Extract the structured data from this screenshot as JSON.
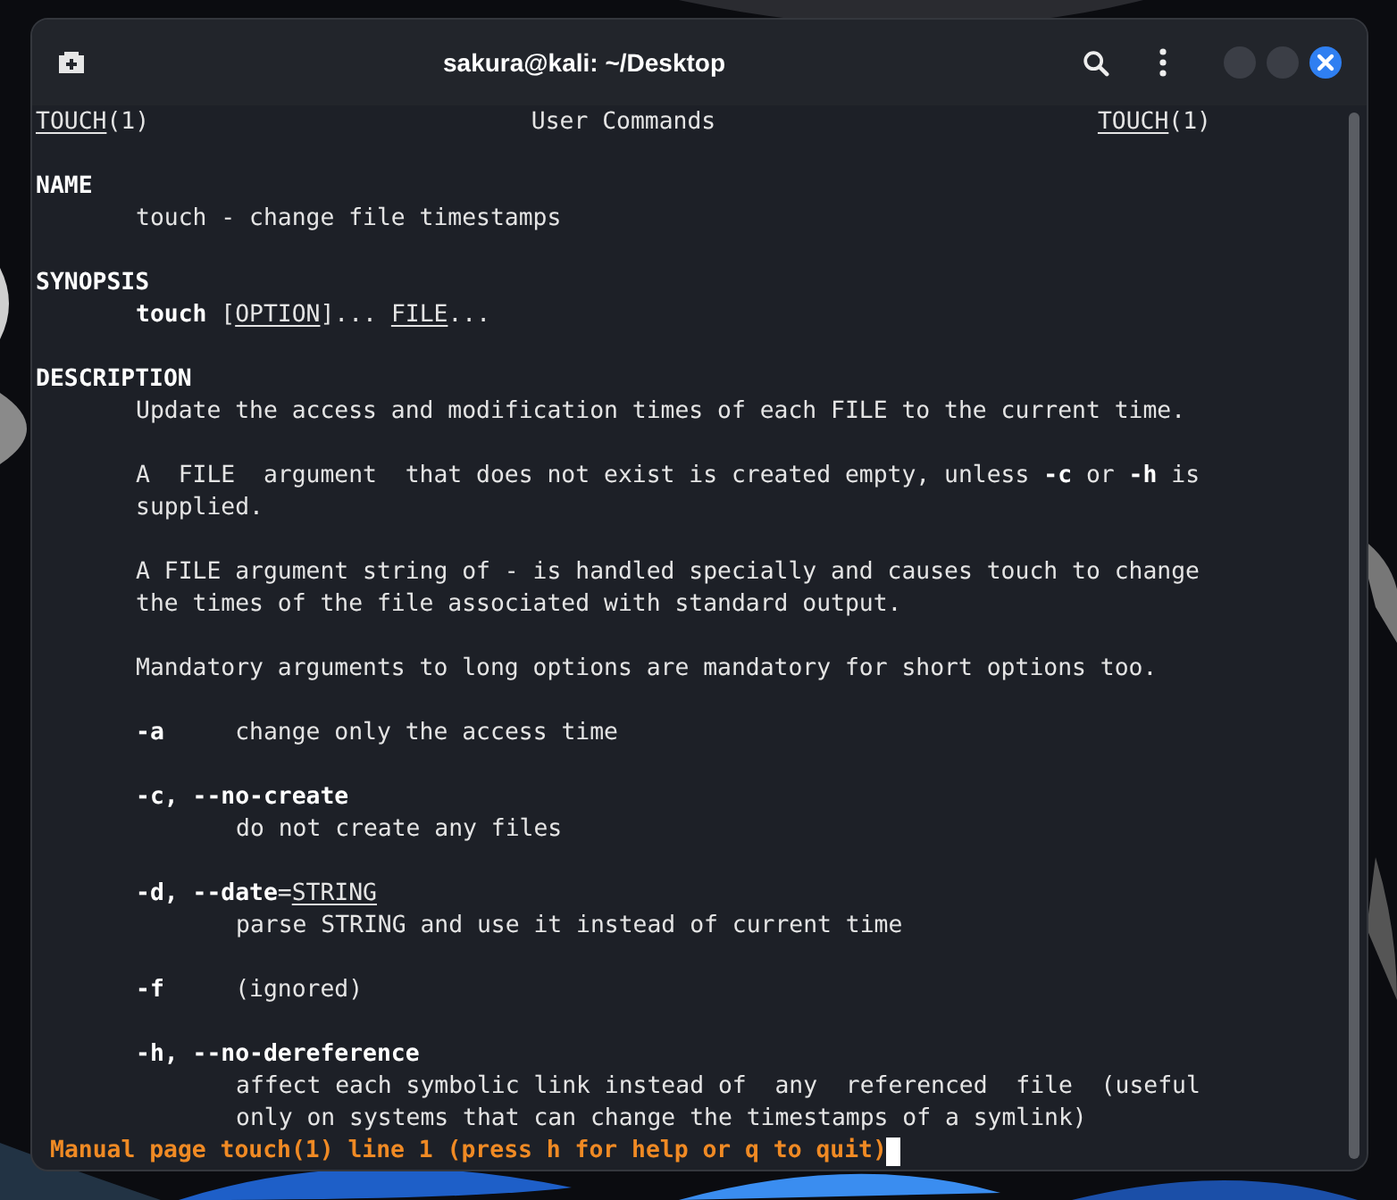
{
  "window": {
    "title": "sakura@kali: ~/Desktop"
  },
  "man_header": {
    "left": [
      {
        "text": "TOUCH",
        "kind": "arg"
      },
      {
        "text": "(1)",
        "kind": "text"
      }
    ],
    "center": "User Commands",
    "right": [
      {
        "text": "TOUCH",
        "kind": "arg"
      },
      {
        "text": "(1)",
        "kind": "text"
      }
    ]
  },
  "sections": [
    {
      "heading": "NAME",
      "paragraphs": [
        {
          "lines": [
            {
              "kind": "body",
              "segments": [
                {
                  "text": "touch - change file timestamps",
                  "kind": "text"
                }
              ]
            }
          ]
        }
      ]
    },
    {
      "heading": "SYNOPSIS",
      "paragraphs": [
        {
          "lines": [
            {
              "kind": "body",
              "segments": [
                {
                  "text": "touch",
                  "kind": "flag"
                },
                {
                  "text": " [",
                  "kind": "text"
                },
                {
                  "text": "OPTION",
                  "kind": "arg"
                },
                {
                  "text": "]... ",
                  "kind": "text"
                },
                {
                  "text": "FILE",
                  "kind": "arg"
                },
                {
                  "text": "...",
                  "kind": "text"
                }
              ]
            }
          ]
        }
      ]
    },
    {
      "heading": "DESCRIPTION",
      "paragraphs": [
        {
          "lines": [
            {
              "kind": "body",
              "segments": [
                {
                  "text": "Update the access and modification times of each FILE to the current time.",
                  "kind": "text"
                }
              ]
            }
          ]
        },
        {
          "lines": [
            {
              "kind": "body",
              "segments": [
                {
                  "text": "A  FILE  argument  that does not exist is created empty, unless ",
                  "kind": "text"
                },
                {
                  "text": "-c",
                  "kind": "flag"
                },
                {
                  "text": " or ",
                  "kind": "text"
                },
                {
                  "text": "-h",
                  "kind": "flag"
                },
                {
                  "text": " is",
                  "kind": "text"
                }
              ]
            },
            {
              "kind": "body",
              "segments": [
                {
                  "text": "supplied.",
                  "kind": "text"
                }
              ]
            }
          ]
        },
        {
          "lines": [
            {
              "kind": "body",
              "segments": [
                {
                  "text": "A FILE argument string of - is handled specially and causes touch to change",
                  "kind": "text"
                }
              ]
            },
            {
              "kind": "body",
              "segments": [
                {
                  "text": "the times of the file associated with standard output.",
                  "kind": "text"
                }
              ]
            }
          ]
        },
        {
          "lines": [
            {
              "kind": "body",
              "segments": [
                {
                  "text": "Mandatory arguments to long options are mandatory for short options too.",
                  "kind": "text"
                }
              ]
            }
          ]
        },
        {
          "lines": [
            {
              "kind": "body",
              "segments": [
                {
                  "text": "-a",
                  "kind": "flag"
                },
                {
                  "text": "     change only the access time",
                  "kind": "text"
                }
              ]
            }
          ]
        },
        {
          "lines": [
            {
              "kind": "body",
              "segments": [
                {
                  "text": "-c, --no-create",
                  "kind": "flag"
                }
              ]
            },
            {
              "kind": "detail",
              "segments": [
                {
                  "text": "do not create any files",
                  "kind": "text"
                }
              ]
            }
          ]
        },
        {
          "lines": [
            {
              "kind": "body",
              "segments": [
                {
                  "text": "-d, --date",
                  "kind": "flag"
                },
                {
                  "text": "=",
                  "kind": "text"
                },
                {
                  "text": "STRING",
                  "kind": "arg"
                }
              ]
            },
            {
              "kind": "detail",
              "segments": [
                {
                  "text": "parse STRING and use it instead of current time",
                  "kind": "text"
                }
              ]
            }
          ]
        },
        {
          "lines": [
            {
              "kind": "body",
              "segments": [
                {
                  "text": "-f",
                  "kind": "flag"
                },
                {
                  "text": "     (ignored)",
                  "kind": "text"
                }
              ]
            }
          ]
        },
        {
          "lines": [
            {
              "kind": "body",
              "segments": [
                {
                  "text": "-h, --no-dereference",
                  "kind": "flag"
                }
              ]
            },
            {
              "kind": "detail",
              "segments": [
                {
                  "text": "affect each symbolic link instead of  any  referenced  file  (useful",
                  "kind": "text"
                }
              ]
            },
            {
              "kind": "detail",
              "segments": [
                {
                  "text": "only on systems that can change the timestamps of a symlink)",
                  "kind": "text"
                }
              ]
            }
          ]
        }
      ]
    }
  ],
  "status_line": "Manual page touch(1) line 1 (press h for help or q to quit)"
}
